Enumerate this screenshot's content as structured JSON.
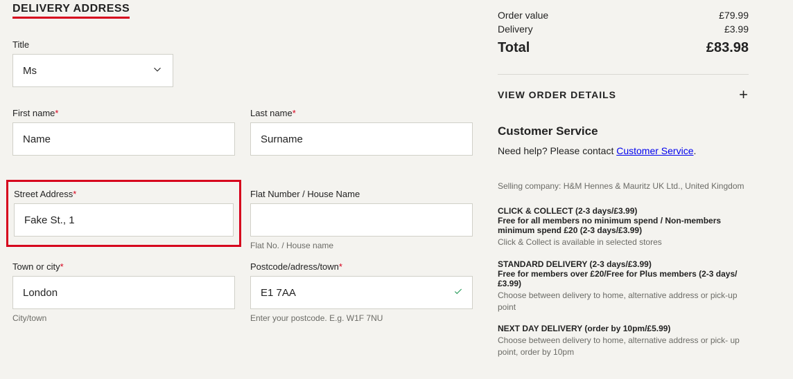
{
  "heading": "DELIVERY ADDRESS",
  "fields": {
    "title": {
      "label": "Title",
      "value": "Ms"
    },
    "firstName": {
      "label": "First name",
      "value": "Name"
    },
    "lastName": {
      "label": "Last name",
      "value": "Surname"
    },
    "street": {
      "label": "Street Address",
      "value": "Fake St., 1"
    },
    "flat": {
      "label": "Flat Number / House Name",
      "value": "",
      "hint": "Flat No. / House name"
    },
    "town": {
      "label": "Town or city",
      "value": "London",
      "hint": "City/town"
    },
    "postcode": {
      "label": "Postcode/adress/town",
      "value": "E1 7AA",
      "hint": "Enter your postcode. E.g. W1F 7NU"
    }
  },
  "summary": {
    "orderValueLabel": "Order value",
    "orderValue": "£79.99",
    "deliveryLabel": "Delivery",
    "delivery": "£3.99",
    "totalLabel": "Total",
    "total": "£83.98",
    "viewDetails": "VIEW ORDER DETAILS"
  },
  "customerService": {
    "heading": "Customer Service",
    "prefix": "Need help? Please contact ",
    "linkText": "Customer Service",
    "suffix": "."
  },
  "selling": "Selling company: H&M Hennes & Mauritz UK Ltd., United Kingdom",
  "shipping": [
    {
      "title": "CLICK & COLLECT (2-3 days/£3.99)",
      "bold": "Free for all members no minimum spend / Non-members minimum spend £20 (2-3 days/£3.99)",
      "desc": "Click & Collect is available in selected stores"
    },
    {
      "title": "STANDARD DELIVERY (2-3 days/£3.99)",
      "bold": "Free for members over £20/Free for Plus members (2-3 days/£3.99)",
      "desc": "Choose between delivery to home, alternative address or pick-up point"
    },
    {
      "title": "NEXT DAY DELIVERY (order by 10pm/£5.99)",
      "bold": "",
      "desc": "Choose between delivery to home, alternative address or pick- up point, order by 10pm"
    }
  ]
}
